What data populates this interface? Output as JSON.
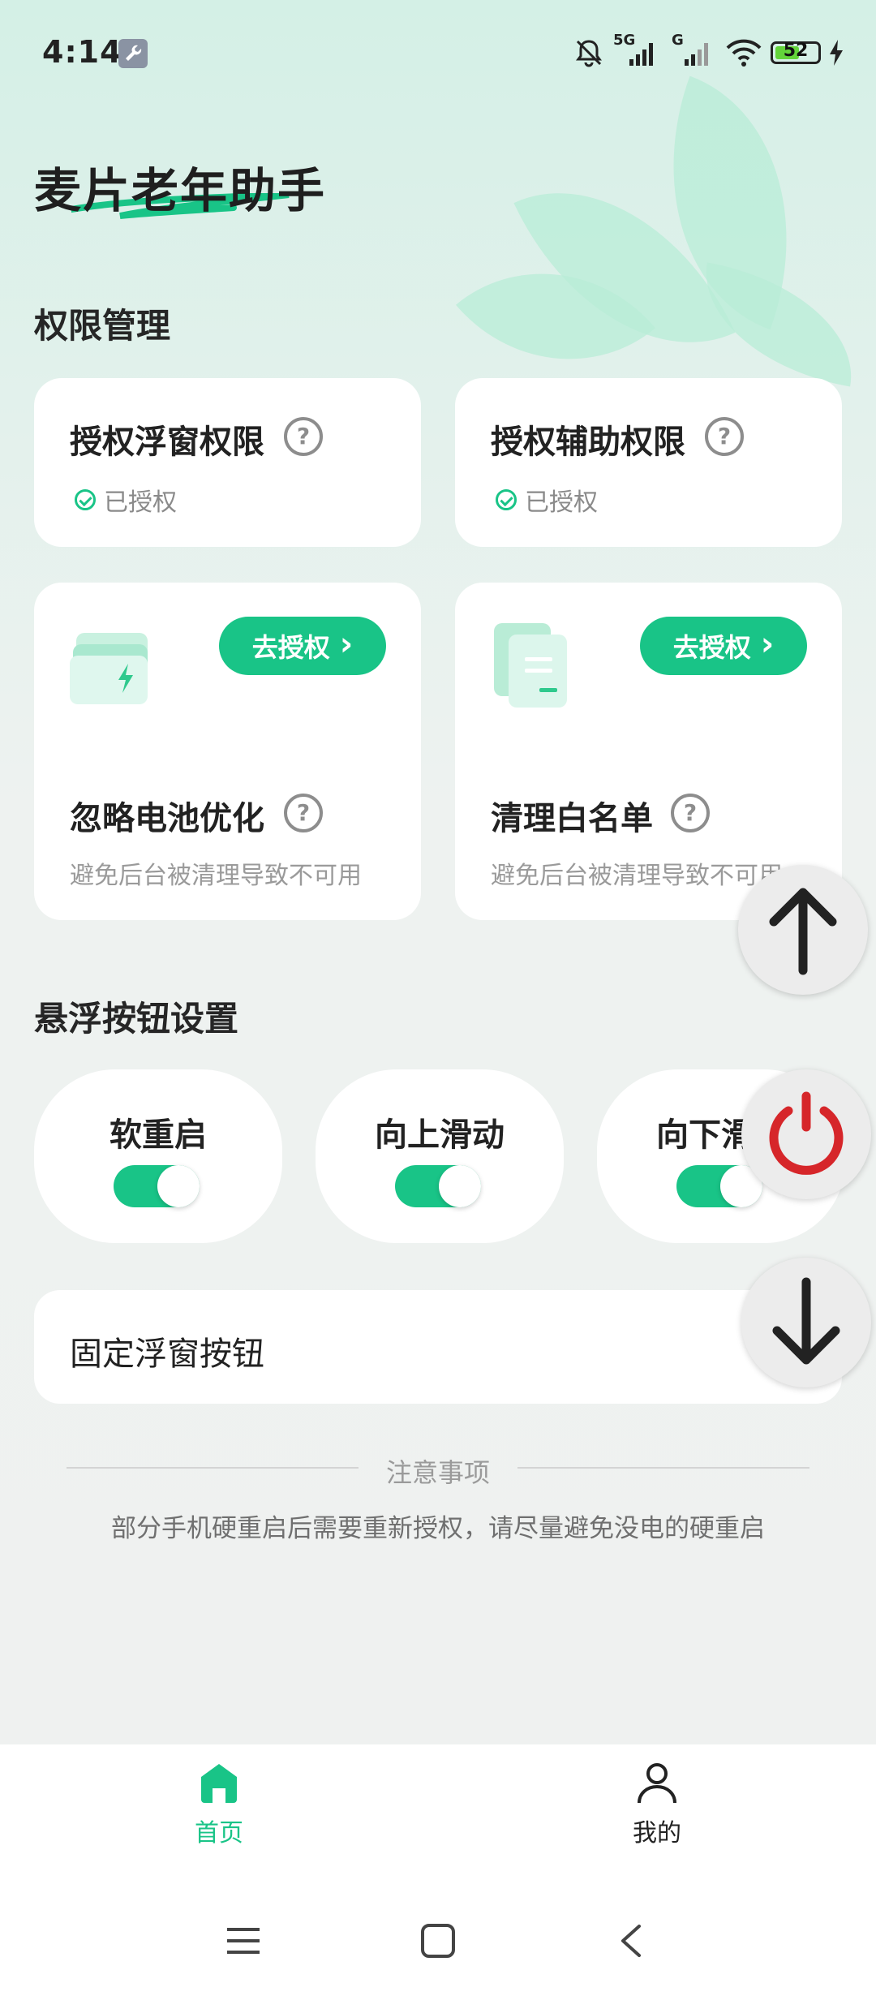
{
  "status_bar": {
    "time": "4:14",
    "network_5g": "5G",
    "network_g": "G",
    "battery": "52"
  },
  "app": {
    "title": "麦片老年助手"
  },
  "permissions": {
    "section_title": "权限管理",
    "floating": {
      "title": "授权浮窗权限",
      "status": "已授权"
    },
    "accessibility": {
      "title": "授权辅助权限",
      "status": "已授权"
    },
    "battery": {
      "title": "忽略电池优化",
      "button": "去授权",
      "desc": "避免后台被清理导致不可用"
    },
    "whitelist": {
      "title": "清理白名单",
      "button": "去授权",
      "desc": "避免后台被清理导致不可用"
    },
    "help_glyph": "?"
  },
  "float_settings": {
    "section_title": "悬浮按钮设置",
    "toggles": [
      {
        "label": "软重启",
        "on": true
      },
      {
        "label": "向上滑动",
        "on": true
      },
      {
        "label": "向下滑动",
        "on": true
      }
    ],
    "fixed_label": "固定浮窗按钮"
  },
  "notice": {
    "title": "注意事项",
    "text": "部分手机硬重启后需要重新授权，请尽量避免没电的硬重启"
  },
  "bottom_nav": {
    "home": "首页",
    "mine": "我的",
    "active_color": "#19c487"
  },
  "colors": {
    "accent": "#19c487",
    "power": "#d6262a"
  }
}
